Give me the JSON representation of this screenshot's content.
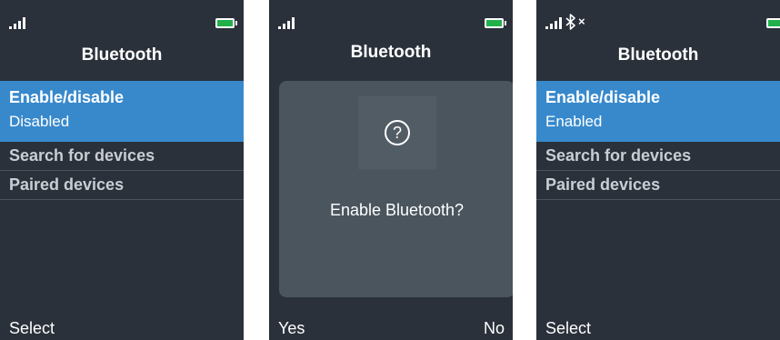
{
  "screens": [
    {
      "title": "Bluetooth",
      "menu": [
        {
          "label": "Enable/disable",
          "value": "Disabled"
        },
        {
          "label": "Search for devices"
        },
        {
          "label": "Paired devices"
        }
      ],
      "softkeys": {
        "left": "Select"
      }
    },
    {
      "title": "Bluetooth",
      "dialog": {
        "icon": "question-icon",
        "message": "Enable Bluetooth?"
      },
      "softkeys": {
        "left": "Yes",
        "right": "No"
      }
    },
    {
      "title": "Bluetooth",
      "status_icons": [
        "signal-icon",
        "bluetooth-icon",
        "close-icon"
      ],
      "menu": [
        {
          "label": "Enable/disable",
          "value": "Enabled"
        },
        {
          "label": "Search for devices"
        },
        {
          "label": "Paired devices"
        }
      ],
      "softkeys": {
        "left": "Select"
      }
    }
  ],
  "status": {
    "close_glyph": "×",
    "question_glyph": "?",
    "battery_color": "#22b04b"
  },
  "colors": {
    "background": "#2a313a",
    "selected": "#3889cc",
    "dialog": "#4a555e"
  }
}
